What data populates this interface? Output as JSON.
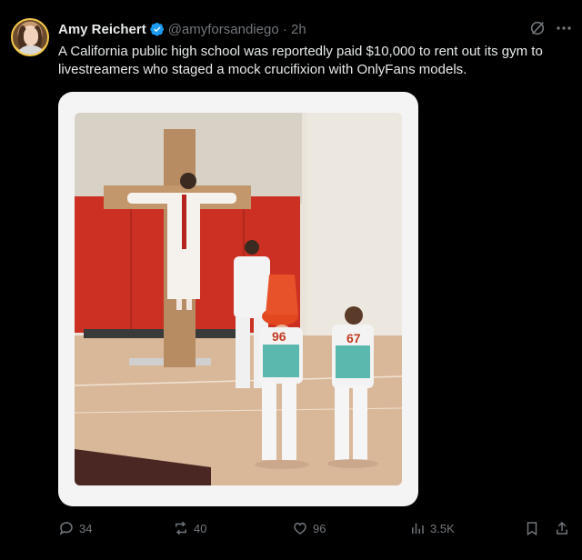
{
  "author": {
    "name": "Amy Reichert",
    "handle": "@amyforsandiego · 2h"
  },
  "tweet": {
    "text": "A California public high school was reportedly paid $10,000 to rent out its gym to livestreamers who staged a mock crucifixion with OnlyFans models."
  },
  "media": {
    "jersey_numbers": [
      "96",
      "67"
    ]
  },
  "actions": {
    "replies": "34",
    "reposts": "40",
    "likes": "96",
    "views": "3.5K"
  },
  "colors": {
    "background": "#000000",
    "text": "#e7e9ea",
    "muted": "#71767b",
    "verified": "#1d9bf0"
  },
  "icons": [
    "verified-badge-icon",
    "grok-icon",
    "more-icon",
    "reply-icon",
    "repost-icon",
    "like-icon",
    "views-icon",
    "bookmark-icon",
    "share-icon"
  ]
}
